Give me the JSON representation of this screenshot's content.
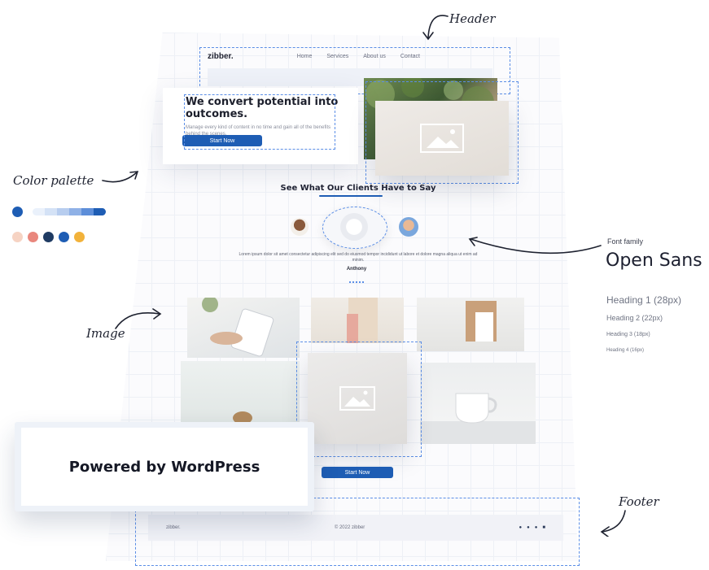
{
  "callouts": {
    "header": "Header",
    "color_palette": "Color palette",
    "image": "Image",
    "footer": "Footer",
    "font_family_label": "Font family",
    "font_family_name": "Open Sans"
  },
  "font_samples": [
    "Heading 1 (28px)",
    "Heading 2 (22px)",
    "Heading 3 (18px)",
    "Heading 4 (16px)"
  ],
  "palette": {
    "check_color": "#1e5db4",
    "blues": [
      "#eaf1fb",
      "#d4e2f6",
      "#b7cdef",
      "#8fb1e6",
      "#5d8ed9",
      "#1e5db4"
    ],
    "accents": [
      "#f6d3c3",
      "#e9877d",
      "#1f3b63",
      "#1e5db4",
      "#f2b23a"
    ]
  },
  "site": {
    "logo": "zibber.",
    "nav": [
      "Home",
      "Services",
      "About us",
      "Contact"
    ],
    "hero_title": "We convert potential into outcomes.",
    "hero_sub": "Manage every kind of content in no time and gain all of the benefits behind the scenes.",
    "hero_button": "Start Now",
    "section_title": "See What Our Clients Have to Say",
    "testimonial": "Lorem ipsum dolor sit amet consectetur adipiscing elit sed do eiusmod tempor incididunt ut labore et dolore magna aliqua ut enim ad minim.",
    "testimonial_author": "Anthony",
    "gallery_button": "Start Now",
    "footer_logo": "zibber.",
    "footer_copy": "© 2022 zibber",
    "social": [
      "twitter-icon",
      "facebook-icon",
      "linkedin-icon",
      "mail-icon"
    ]
  },
  "powered_by": "Powered by WordPress"
}
